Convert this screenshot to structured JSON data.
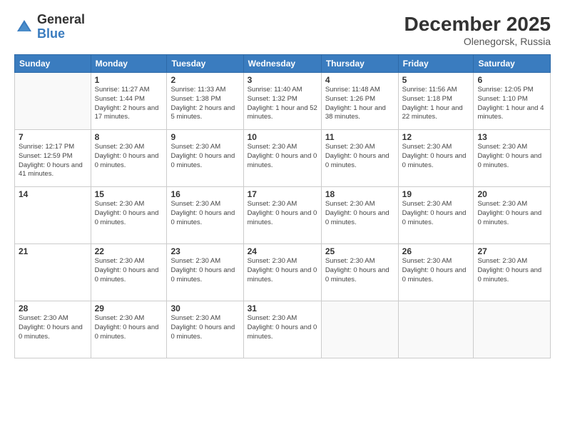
{
  "header": {
    "logo_general": "General",
    "logo_blue": "Blue",
    "month_year": "December 2025",
    "location": "Olenegorsk, Russia"
  },
  "days_of_week": [
    "Sunday",
    "Monday",
    "Tuesday",
    "Wednesday",
    "Thursday",
    "Friday",
    "Saturday"
  ],
  "weeks": [
    [
      {
        "num": "",
        "info": ""
      },
      {
        "num": "1",
        "info": "Sunrise: 11:27 AM\nSunset: 1:44 PM\nDaylight: 2 hours and 17 minutes."
      },
      {
        "num": "2",
        "info": "Sunrise: 11:33 AM\nSunset: 1:38 PM\nDaylight: 2 hours and 5 minutes."
      },
      {
        "num": "3",
        "info": "Sunrise: 11:40 AM\nSunset: 1:32 PM\nDaylight: 1 hour and 52 minutes."
      },
      {
        "num": "4",
        "info": "Sunrise: 11:48 AM\nSunset: 1:26 PM\nDaylight: 1 hour and 38 minutes."
      },
      {
        "num": "5",
        "info": "Sunrise: 11:56 AM\nSunset: 1:18 PM\nDaylight: 1 hour and 22 minutes."
      },
      {
        "num": "6",
        "info": "Sunrise: 12:05 PM\nSunset: 1:10 PM\nDaylight: 1 hour and 4 minutes."
      }
    ],
    [
      {
        "num": "7",
        "info": "Sunrise: 12:17 PM\nSunset: 12:59 PM\nDaylight: 0 hours and 41 minutes."
      },
      {
        "num": "8",
        "info": "Sunset: 2:30 AM\nDaylight: 0 hours and 0 minutes."
      },
      {
        "num": "9",
        "info": "Sunset: 2:30 AM\nDaylight: 0 hours and 0 minutes."
      },
      {
        "num": "10",
        "info": "Sunset: 2:30 AM\nDaylight: 0 hours and 0 minutes."
      },
      {
        "num": "11",
        "info": "Sunset: 2:30 AM\nDaylight: 0 hours and 0 minutes."
      },
      {
        "num": "12",
        "info": "Sunset: 2:30 AM\nDaylight: 0 hours and 0 minutes."
      },
      {
        "num": "13",
        "info": "Sunset: 2:30 AM\nDaylight: 0 hours and 0 minutes."
      }
    ],
    [
      {
        "num": "14",
        "info": ""
      },
      {
        "num": "15",
        "info": "Sunset: 2:30 AM\nDaylight: 0 hours and 0 minutes."
      },
      {
        "num": "16",
        "info": "Sunset: 2:30 AM\nDaylight: 0 hours and 0 minutes."
      },
      {
        "num": "17",
        "info": "Sunset: 2:30 AM\nDaylight: 0 hours and 0 minutes."
      },
      {
        "num": "18",
        "info": "Sunset: 2:30 AM\nDaylight: 0 hours and 0 minutes."
      },
      {
        "num": "19",
        "info": "Sunset: 2:30 AM\nDaylight: 0 hours and 0 minutes."
      },
      {
        "num": "20",
        "info": "Sunset: 2:30 AM\nDaylight: 0 hours and 0 minutes."
      }
    ],
    [
      {
        "num": "21",
        "info": ""
      },
      {
        "num": "22",
        "info": "Sunset: 2:30 AM\nDaylight: 0 hours and 0 minutes."
      },
      {
        "num": "23",
        "info": "Sunset: 2:30 AM\nDaylight: 0 hours and 0 minutes."
      },
      {
        "num": "24",
        "info": "Sunset: 2:30 AM\nDaylight: 0 hours and 0 minutes."
      },
      {
        "num": "25",
        "info": "Sunset: 2:30 AM\nDaylight: 0 hours and 0 minutes."
      },
      {
        "num": "26",
        "info": "Sunset: 2:30 AM\nDaylight: 0 hours and 0 minutes."
      },
      {
        "num": "27",
        "info": "Sunset: 2:30 AM\nDaylight: 0 hours and 0 minutes."
      }
    ],
    [
      {
        "num": "28",
        "info": "Sunset: 2:30 AM\nDaylight: 0 hours and 0 minutes."
      },
      {
        "num": "29",
        "info": "Sunset: 2:30 AM\nDaylight: 0 hours and 0 minutes."
      },
      {
        "num": "30",
        "info": "Sunset: 2:30 AM\nDaylight: 0 hours and 0 minutes."
      },
      {
        "num": "31",
        "info": "Sunset: 2:30 AM\nDaylight: 0 hours and 0 minutes."
      },
      {
        "num": "",
        "info": ""
      },
      {
        "num": "",
        "info": ""
      },
      {
        "num": "",
        "info": ""
      }
    ]
  ]
}
